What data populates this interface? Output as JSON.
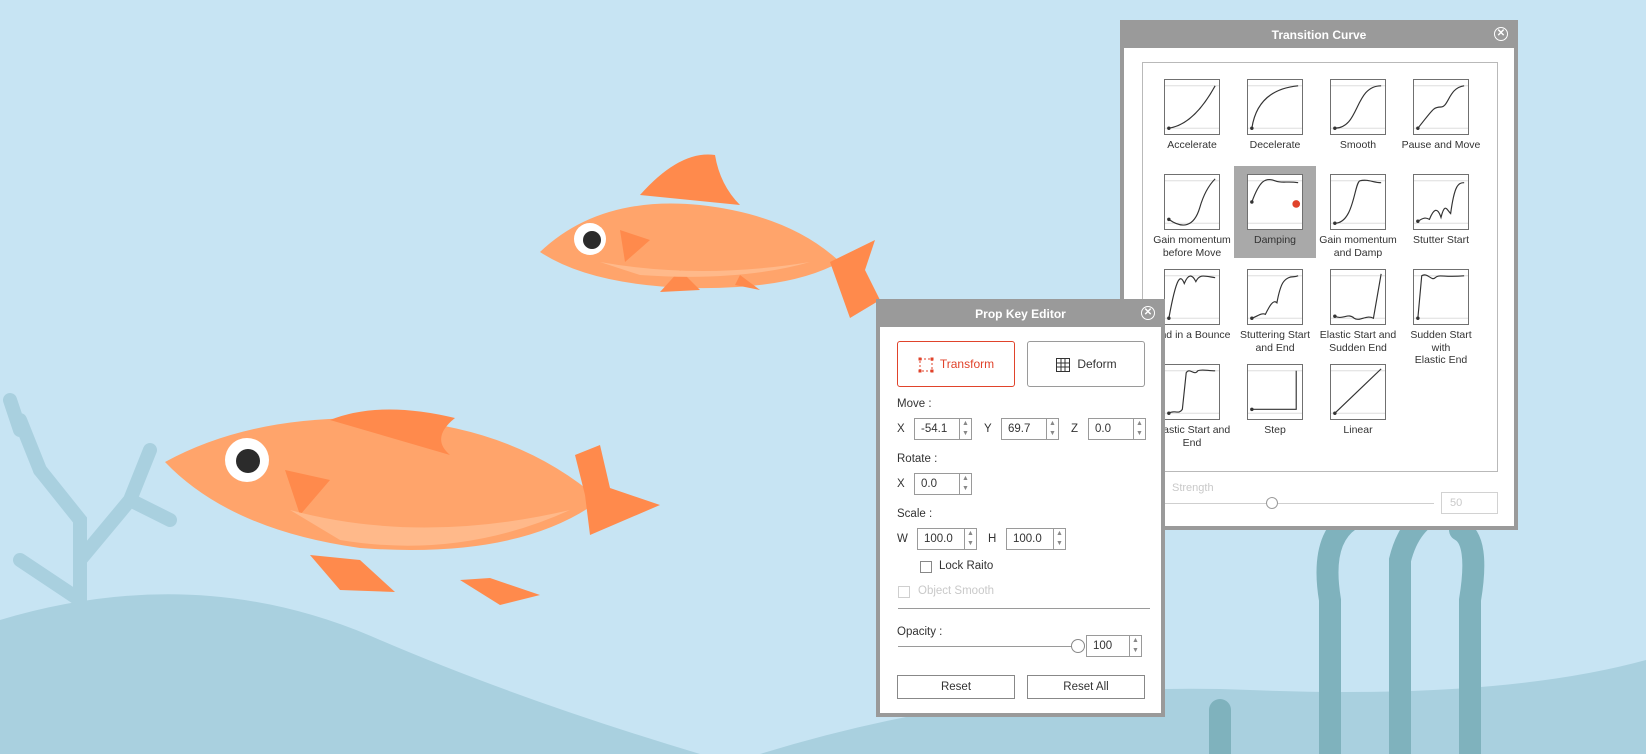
{
  "transition_curve": {
    "title": "Transition Curve",
    "presets": [
      {
        "label": "Accelerate",
        "curve": "accelerate"
      },
      {
        "label": "Decelerate",
        "curve": "decelerate"
      },
      {
        "label": "Smooth",
        "curve": "smooth"
      },
      {
        "label": "Pause and Move",
        "curve": "pause-move"
      },
      {
        "label": "Gain momentum\nbefore Move",
        "curve": "gain-before"
      },
      {
        "label": "Damping",
        "curve": "damping",
        "selected": true
      },
      {
        "label": "Gain momentum\nand Damp",
        "curve": "gain-damp"
      },
      {
        "label": "Stutter Start",
        "curve": "stutter-start"
      },
      {
        "label": "End in a Bounce",
        "curve": "end-bounce"
      },
      {
        "label": "Stuttering Start\nand End",
        "curve": "stutter-start-end"
      },
      {
        "label": "Elastic Start and\nSudden End",
        "curve": "elastic-start-sudden-end"
      },
      {
        "label": "Sudden Start with\nElastic End",
        "curve": "sudden-start-elastic-end"
      },
      {
        "label": "Elastic Start and\nEnd",
        "curve": "elastic-start-end"
      },
      {
        "label": "Step",
        "curve": "step"
      },
      {
        "label": "Linear",
        "curve": "linear"
      }
    ],
    "strength_label": "Strength",
    "strength_value": "50",
    "strength_level": 0.4
  },
  "prop_key_editor": {
    "title": "Prop Key Editor",
    "modes": {
      "transform": "Transform",
      "deform": "Deform"
    },
    "move": {
      "label": "Move :",
      "x_label": "X",
      "x": "-54.1",
      "y_label": "Y",
      "y": "69.7",
      "z_label": "Z",
      "z": "0.0"
    },
    "rotate": {
      "label": "Rotate :",
      "x_label": "X",
      "x": "0.0"
    },
    "scale": {
      "label": "Scale :",
      "w_label": "W",
      "w": "100.0",
      "h_label": "H",
      "h": "100.0"
    },
    "lock_ratio": "Lock Raito",
    "object_smooth": "Object Smooth",
    "opacity": {
      "label": "Opacity :",
      "value": "100",
      "level": 1.0
    },
    "reset": "Reset",
    "reset_all": "Reset All"
  },
  "colors": {
    "background": "#c7e4f3",
    "fish": "#ffa46b",
    "fin": "#ff8a4c",
    "accent_red": "#e0432b",
    "dialog_frame": "#9a9a9a"
  }
}
